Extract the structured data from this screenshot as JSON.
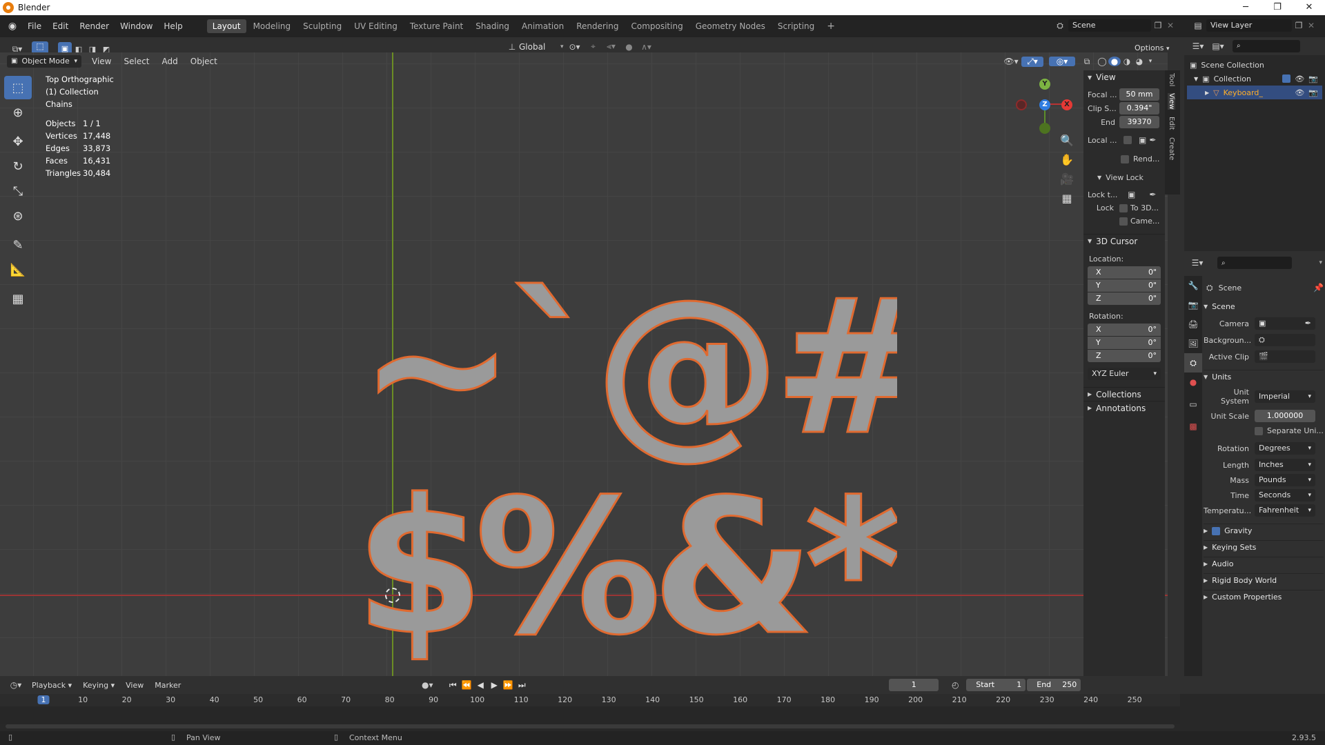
{
  "window": {
    "title": "Blender",
    "controls": [
      "─",
      "❐",
      "✕"
    ]
  },
  "menus": [
    "File",
    "Edit",
    "Render",
    "Window",
    "Help"
  ],
  "workspaces": [
    "Layout",
    "Modeling",
    "Sculpting",
    "UV Editing",
    "Texture Paint",
    "Shading",
    "Animation",
    "Rendering",
    "Compositing",
    "Geometry Nodes",
    "Scripting"
  ],
  "workspace_add": "+",
  "scene_name": "Scene",
  "view_layer_name": "View Layer",
  "header": {
    "transform_orientation": "Global",
    "options_label": "Options",
    "mode": "Object Mode",
    "menus": [
      "View",
      "Select",
      "Add",
      "Object"
    ]
  },
  "overlay_info": {
    "view_name": "Top Orthographic",
    "collection": "(1) Collection",
    "object": "Chains",
    "stats": [
      {
        "label": "Objects",
        "value": "1 / 1"
      },
      {
        "label": "Vertices",
        "value": "17,448"
      },
      {
        "label": "Edges",
        "value": "33,873"
      },
      {
        "label": "Faces",
        "value": "16,431"
      },
      {
        "label": "Triangles",
        "value": "30,484"
      }
    ]
  },
  "viewport_text": {
    "line1": "~`@#",
    "line2": "$%&*()"
  },
  "gizmo": {
    "x": "X",
    "y": "Y",
    "z": "Z"
  },
  "npanel": {
    "tabs": [
      "Tool",
      "View",
      "Edit",
      "Create"
    ],
    "view_section": "View",
    "focal_label": "Focal ...",
    "focal_value": "50 mm",
    "clip_start_label": "Clip S...",
    "clip_start_value": "0.394\"",
    "clip_end_label": "End",
    "clip_end_value": "39370",
    "local_label": "Local ...",
    "render_label": "Rend...",
    "view_lock_section": "View Lock",
    "lock_to_label": "Lock t...",
    "lock_label": "Lock",
    "to3d_label": "To 3D...",
    "camera_label": "Came...",
    "cursor_section": "3D Cursor",
    "location_label": "Location:",
    "location": [
      {
        "axis": "X",
        "value": "0\""
      },
      {
        "axis": "Y",
        "value": "0\""
      },
      {
        "axis": "Z",
        "value": "0\""
      }
    ],
    "rotation_label": "Rotation:",
    "rotation": [
      {
        "axis": "X",
        "value": "0°"
      },
      {
        "axis": "Y",
        "value": "0°"
      },
      {
        "axis": "Z",
        "value": "0°"
      }
    ],
    "rotation_mode": "XYZ Euler",
    "collections_section": "Collections",
    "annotations_section": "Annotations"
  },
  "outliner": {
    "root": "Scene Collection",
    "collection": "Collection",
    "object": "Keyboard_"
  },
  "properties": {
    "scene_header": "Scene",
    "scene_section": "Scene",
    "camera_label": "Camera",
    "background_label": "Backgroun...",
    "active_clip_label": "Active Clip",
    "units_section": "Units",
    "unit_system_label": "Unit System",
    "unit_system_value": "Imperial",
    "unit_scale_label": "Unit Scale",
    "unit_scale_value": "1.000000",
    "separate_units_label": "Separate Uni...",
    "rotation_label": "Rotation",
    "rotation_value": "Degrees",
    "length_label": "Length",
    "length_value": "Inches",
    "mass_label": "Mass",
    "mass_value": "Pounds",
    "time_label": "Time",
    "time_value": "Seconds",
    "temperature_label": "Temperatu...",
    "temperature_value": "Fahrenheit",
    "gravity_label": "Gravity",
    "keying_sets_label": "Keying Sets",
    "audio_label": "Audio",
    "rigid_body_label": "Rigid Body World",
    "custom_props_label": "Custom Properties"
  },
  "timeline": {
    "menus": [
      "Playback",
      "Keying",
      "View",
      "Marker"
    ],
    "current_frame": "1",
    "start_label": "Start",
    "start_value": "1",
    "end_label": "End",
    "end_value": "250",
    "ticks": [
      "1",
      "10",
      "20",
      "30",
      "40",
      "50",
      "60",
      "70",
      "80",
      "90",
      "100",
      "110",
      "120",
      "130",
      "140",
      "150",
      "160",
      "170",
      "180",
      "190",
      "200",
      "210",
      "220",
      "230",
      "240",
      "250"
    ]
  },
  "statusbar": {
    "pan": "Pan View",
    "context": "Context Menu",
    "version": "2.93.5"
  }
}
